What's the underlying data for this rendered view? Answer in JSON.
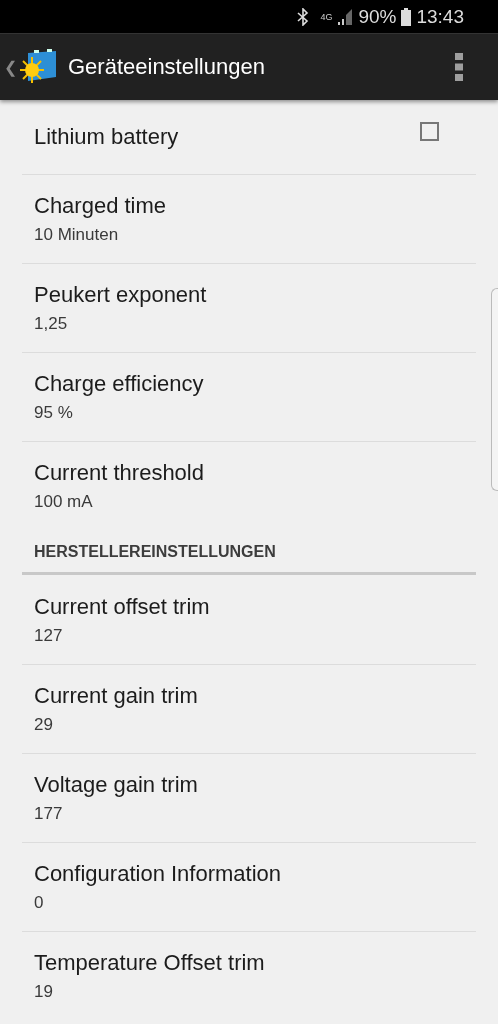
{
  "status_bar": {
    "network": "4G",
    "battery": "90%",
    "time": "13:43"
  },
  "app_bar": {
    "back": "❮",
    "title": "Geräteeinstellungen"
  },
  "sections": [
    {
      "items": [
        {
          "kind": "checkbox",
          "title": "Lithium battery",
          "checked": false
        },
        {
          "kind": "text",
          "title": "Charged time",
          "summary": "10 Minuten"
        },
        {
          "kind": "text",
          "title": "Peukert exponent",
          "summary": "1,25"
        },
        {
          "kind": "text",
          "title": "Charge efficiency",
          "summary": "95 %"
        },
        {
          "kind": "text",
          "title": "Current threshold",
          "summary": "100 mA"
        }
      ]
    },
    {
      "header": "HERSTELLEREINSTELLUNGEN",
      "items": [
        {
          "kind": "text",
          "title": "Current offset trim",
          "summary": "127"
        },
        {
          "kind": "text",
          "title": "Current gain trim",
          "summary": "29"
        },
        {
          "kind": "text",
          "title": "Voltage gain trim",
          "summary": "177"
        },
        {
          "kind": "text",
          "title": "Configuration Information",
          "summary": "0"
        },
        {
          "kind": "text",
          "title": "Temperature Offset trim",
          "summary": "19"
        }
      ]
    }
  ]
}
